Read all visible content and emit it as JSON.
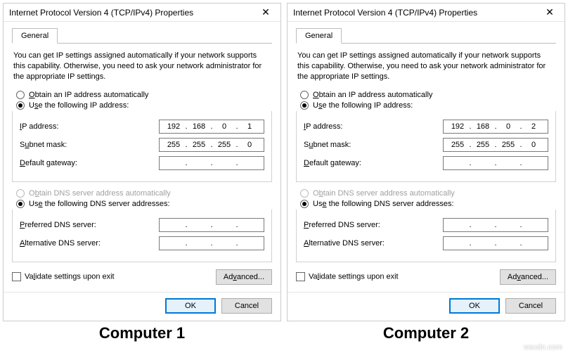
{
  "dialog_title": "Internet Protocol Version 4 (TCP/IPv4) Properties",
  "tab_general": "General",
  "description": "You can get IP settings assigned automatically if your network supports this capability. Otherwise, you need to ask your network administrator for the appropriate IP settings.",
  "radio_ip_auto": "btain an IP address automatically",
  "radio_ip_auto_prefix": "O",
  "radio_ip_manual_prefix": "U",
  "radio_ip_manual": "se the following IP address:",
  "label_ip": "P address:",
  "label_ip_prefix": "I",
  "label_subnet": "bnet mask:",
  "label_subnet_prefix": "Su",
  "label_subnet_u": "u",
  "label_gateway": "efault gateway:",
  "label_gateway_prefix": "D",
  "radio_dns_auto_prefix": "O",
  "radio_dns_auto": "btain DNS server address automatically",
  "radio_dns_manual_prefix": "Us",
  "radio_dns_manual_u": "e",
  "radio_dns_manual": " the following DNS server addresses:",
  "label_pref_dns": "referred DNS server:",
  "label_pref_dns_prefix": "P",
  "label_alt_dns": "lternative DNS server:",
  "label_alt_dns_prefix": "A",
  "validate_label": "alidate settings upon exit",
  "validate_prefix": "V",
  "advanced_btn": "vanced...",
  "advanced_prefix": "Ad",
  "advanced_u": "v",
  "ok_btn": "OK",
  "cancel_btn": "Cancel",
  "panels": [
    {
      "ip": {
        "a": "192",
        "b": "168",
        "c": "0",
        "d": "1"
      },
      "subnet": {
        "a": "255",
        "b": "255",
        "c": "255",
        "d": "0"
      },
      "gateway": {
        "a": "",
        "b": "",
        "c": "",
        "d": ""
      },
      "pref_dns": {
        "a": "",
        "b": "",
        "c": "",
        "d": ""
      },
      "alt_dns": {
        "a": "",
        "b": "",
        "c": "",
        "d": ""
      },
      "caption": "Computer 1"
    },
    {
      "ip": {
        "a": "192",
        "b": "168",
        "c": "0",
        "d": "2"
      },
      "subnet": {
        "a": "255",
        "b": "255",
        "c": "255",
        "d": "0"
      },
      "gateway": {
        "a": "",
        "b": "",
        "c": "",
        "d": ""
      },
      "pref_dns": {
        "a": "",
        "b": "",
        "c": "",
        "d": ""
      },
      "alt_dns": {
        "a": "",
        "b": "",
        "c": "",
        "d": ""
      },
      "caption": "Computer 2"
    }
  ],
  "watermark": "wsxdn.com"
}
